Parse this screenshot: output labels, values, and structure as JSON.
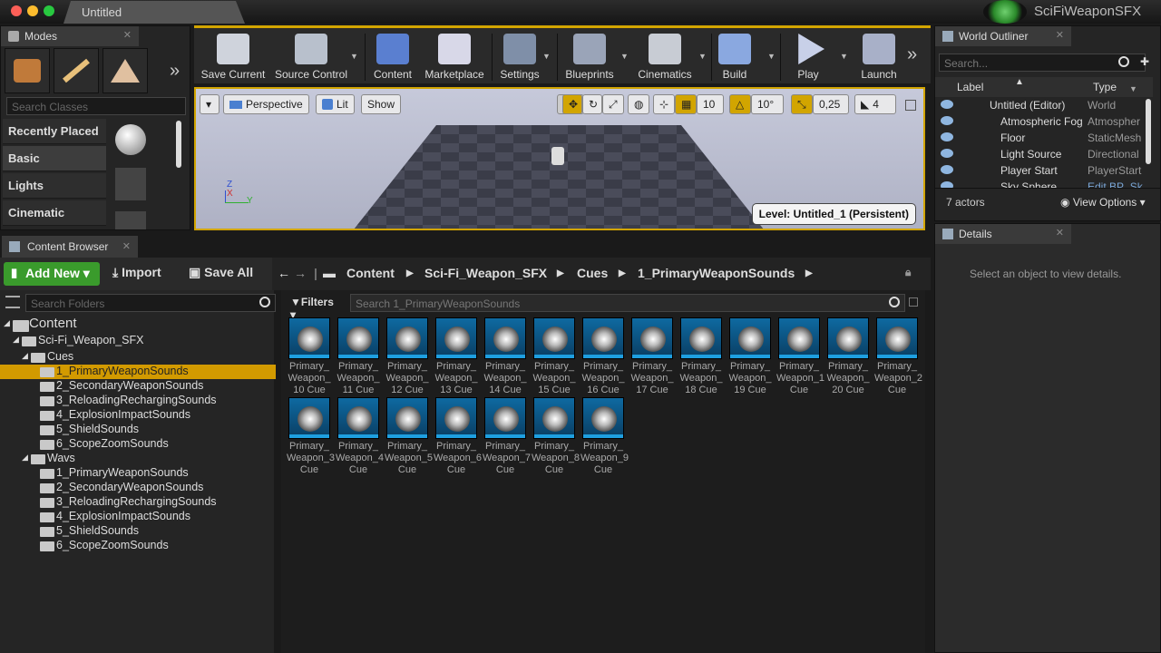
{
  "window": {
    "tab_title": "Untitled",
    "project_name": "SciFiWeaponSFX"
  },
  "modes": {
    "tab": "Modes",
    "search_placeholder": "Search Classes",
    "categories": [
      "Recently Placed",
      "Basic",
      "Lights",
      "Cinematic"
    ]
  },
  "toolbar": {
    "buttons": [
      "Save Current",
      "Source Control",
      "Content",
      "Marketplace",
      "Settings",
      "Blueprints",
      "Cinematics",
      "Build",
      "Play",
      "Launch"
    ]
  },
  "viewport": {
    "perspective": "Perspective",
    "lit": "Lit",
    "show": "Show",
    "grid_snap": "10",
    "rot_snap": "10°",
    "scale_snap": "0,25",
    "cam_speed": "4",
    "level": "Level:  Untitled_1 (Persistent)"
  },
  "outliner": {
    "tab": "World Outliner",
    "search_placeholder": "Search...",
    "col_label": "Label",
    "col_type": "Type",
    "rows": [
      {
        "name": "Untitled (Editor)",
        "type": "World"
      },
      {
        "name": "Atmospheric Fog",
        "type": "Atmospher"
      },
      {
        "name": "Floor",
        "type": "StaticMesh"
      },
      {
        "name": "Light Source",
        "type": "Directional"
      },
      {
        "name": "Player Start",
        "type": "PlayerStart"
      },
      {
        "name": "Sky Sphere",
        "type": "Edit BP_Sk"
      }
    ],
    "actor_count": "7 actors",
    "view_options": "View Options"
  },
  "details": {
    "tab": "Details",
    "empty": "Select an object to view details."
  },
  "content_browser": {
    "tab": "Content Browser",
    "add_new": "Add New",
    "import": "Import",
    "save_all": "Save All",
    "crumbs": [
      "Content",
      "Sci-Fi_Weapon_SFX",
      "Cues",
      "1_PrimaryWeaponSounds"
    ],
    "folder_search": "Search Folders",
    "filters": "Filters",
    "asset_search": "Search 1_PrimaryWeaponSounds",
    "tree": [
      {
        "label": "Content",
        "depth": 0
      },
      {
        "label": "Sci-Fi_Weapon_SFX",
        "depth": 1
      },
      {
        "label": "Cues",
        "depth": 2
      },
      {
        "label": "1_PrimaryWeaponSounds",
        "depth": 3,
        "selected": true
      },
      {
        "label": "2_SecondaryWeaponSounds",
        "depth": 3
      },
      {
        "label": "3_ReloadingRechargingSounds",
        "depth": 3
      },
      {
        "label": "4_ExplosionImpactSounds",
        "depth": 3
      },
      {
        "label": "5_ShieldSounds",
        "depth": 3
      },
      {
        "label": "6_ScopeZoomSounds",
        "depth": 3
      },
      {
        "label": "Wavs",
        "depth": 2
      },
      {
        "label": "1_PrimaryWeaponSounds",
        "depth": 3
      },
      {
        "label": "2_SecondaryWeaponSounds",
        "depth": 3
      },
      {
        "label": "3_ReloadingRechargingSounds",
        "depth": 3
      },
      {
        "label": "4_ExplosionImpactSounds",
        "depth": 3
      },
      {
        "label": "5_ShieldSounds",
        "depth": 3
      },
      {
        "label": "6_ScopeZoomSounds",
        "depth": 3
      }
    ],
    "assets": [
      [
        "Primary_",
        "Weapon_",
        "10 Cue"
      ],
      [
        "Primary_",
        "Weapon_",
        "11 Cue"
      ],
      [
        "Primary_",
        "Weapon_",
        "12 Cue"
      ],
      [
        "Primary_",
        "Weapon_",
        "13 Cue"
      ],
      [
        "Primary_",
        "Weapon_",
        "14 Cue"
      ],
      [
        "Primary_",
        "Weapon_",
        "15 Cue"
      ],
      [
        "Primary_",
        "Weapon_",
        "16 Cue"
      ],
      [
        "Primary_",
        "Weapon_",
        "17 Cue"
      ],
      [
        "Primary_",
        "Weapon_",
        "18 Cue"
      ],
      [
        "Primary_",
        "Weapon_",
        "19 Cue"
      ],
      [
        "Primary_",
        "Weapon_1",
        "Cue"
      ],
      [
        "Primary_",
        "Weapon_",
        "20 Cue"
      ],
      [
        "Primary_",
        "Weapon_2",
        "Cue"
      ],
      [
        "Primary_",
        "Weapon_3",
        "Cue"
      ],
      [
        "Primary_",
        "Weapon_4",
        "Cue"
      ],
      [
        "Primary_",
        "Weapon_5",
        "Cue"
      ],
      [
        "Primary_",
        "Weapon_6",
        "Cue"
      ],
      [
        "Primary_",
        "Weapon_7",
        "Cue"
      ],
      [
        "Primary_",
        "Weapon_8",
        "Cue"
      ],
      [
        "Primary_",
        "Weapon_9",
        "Cue"
      ]
    ]
  }
}
